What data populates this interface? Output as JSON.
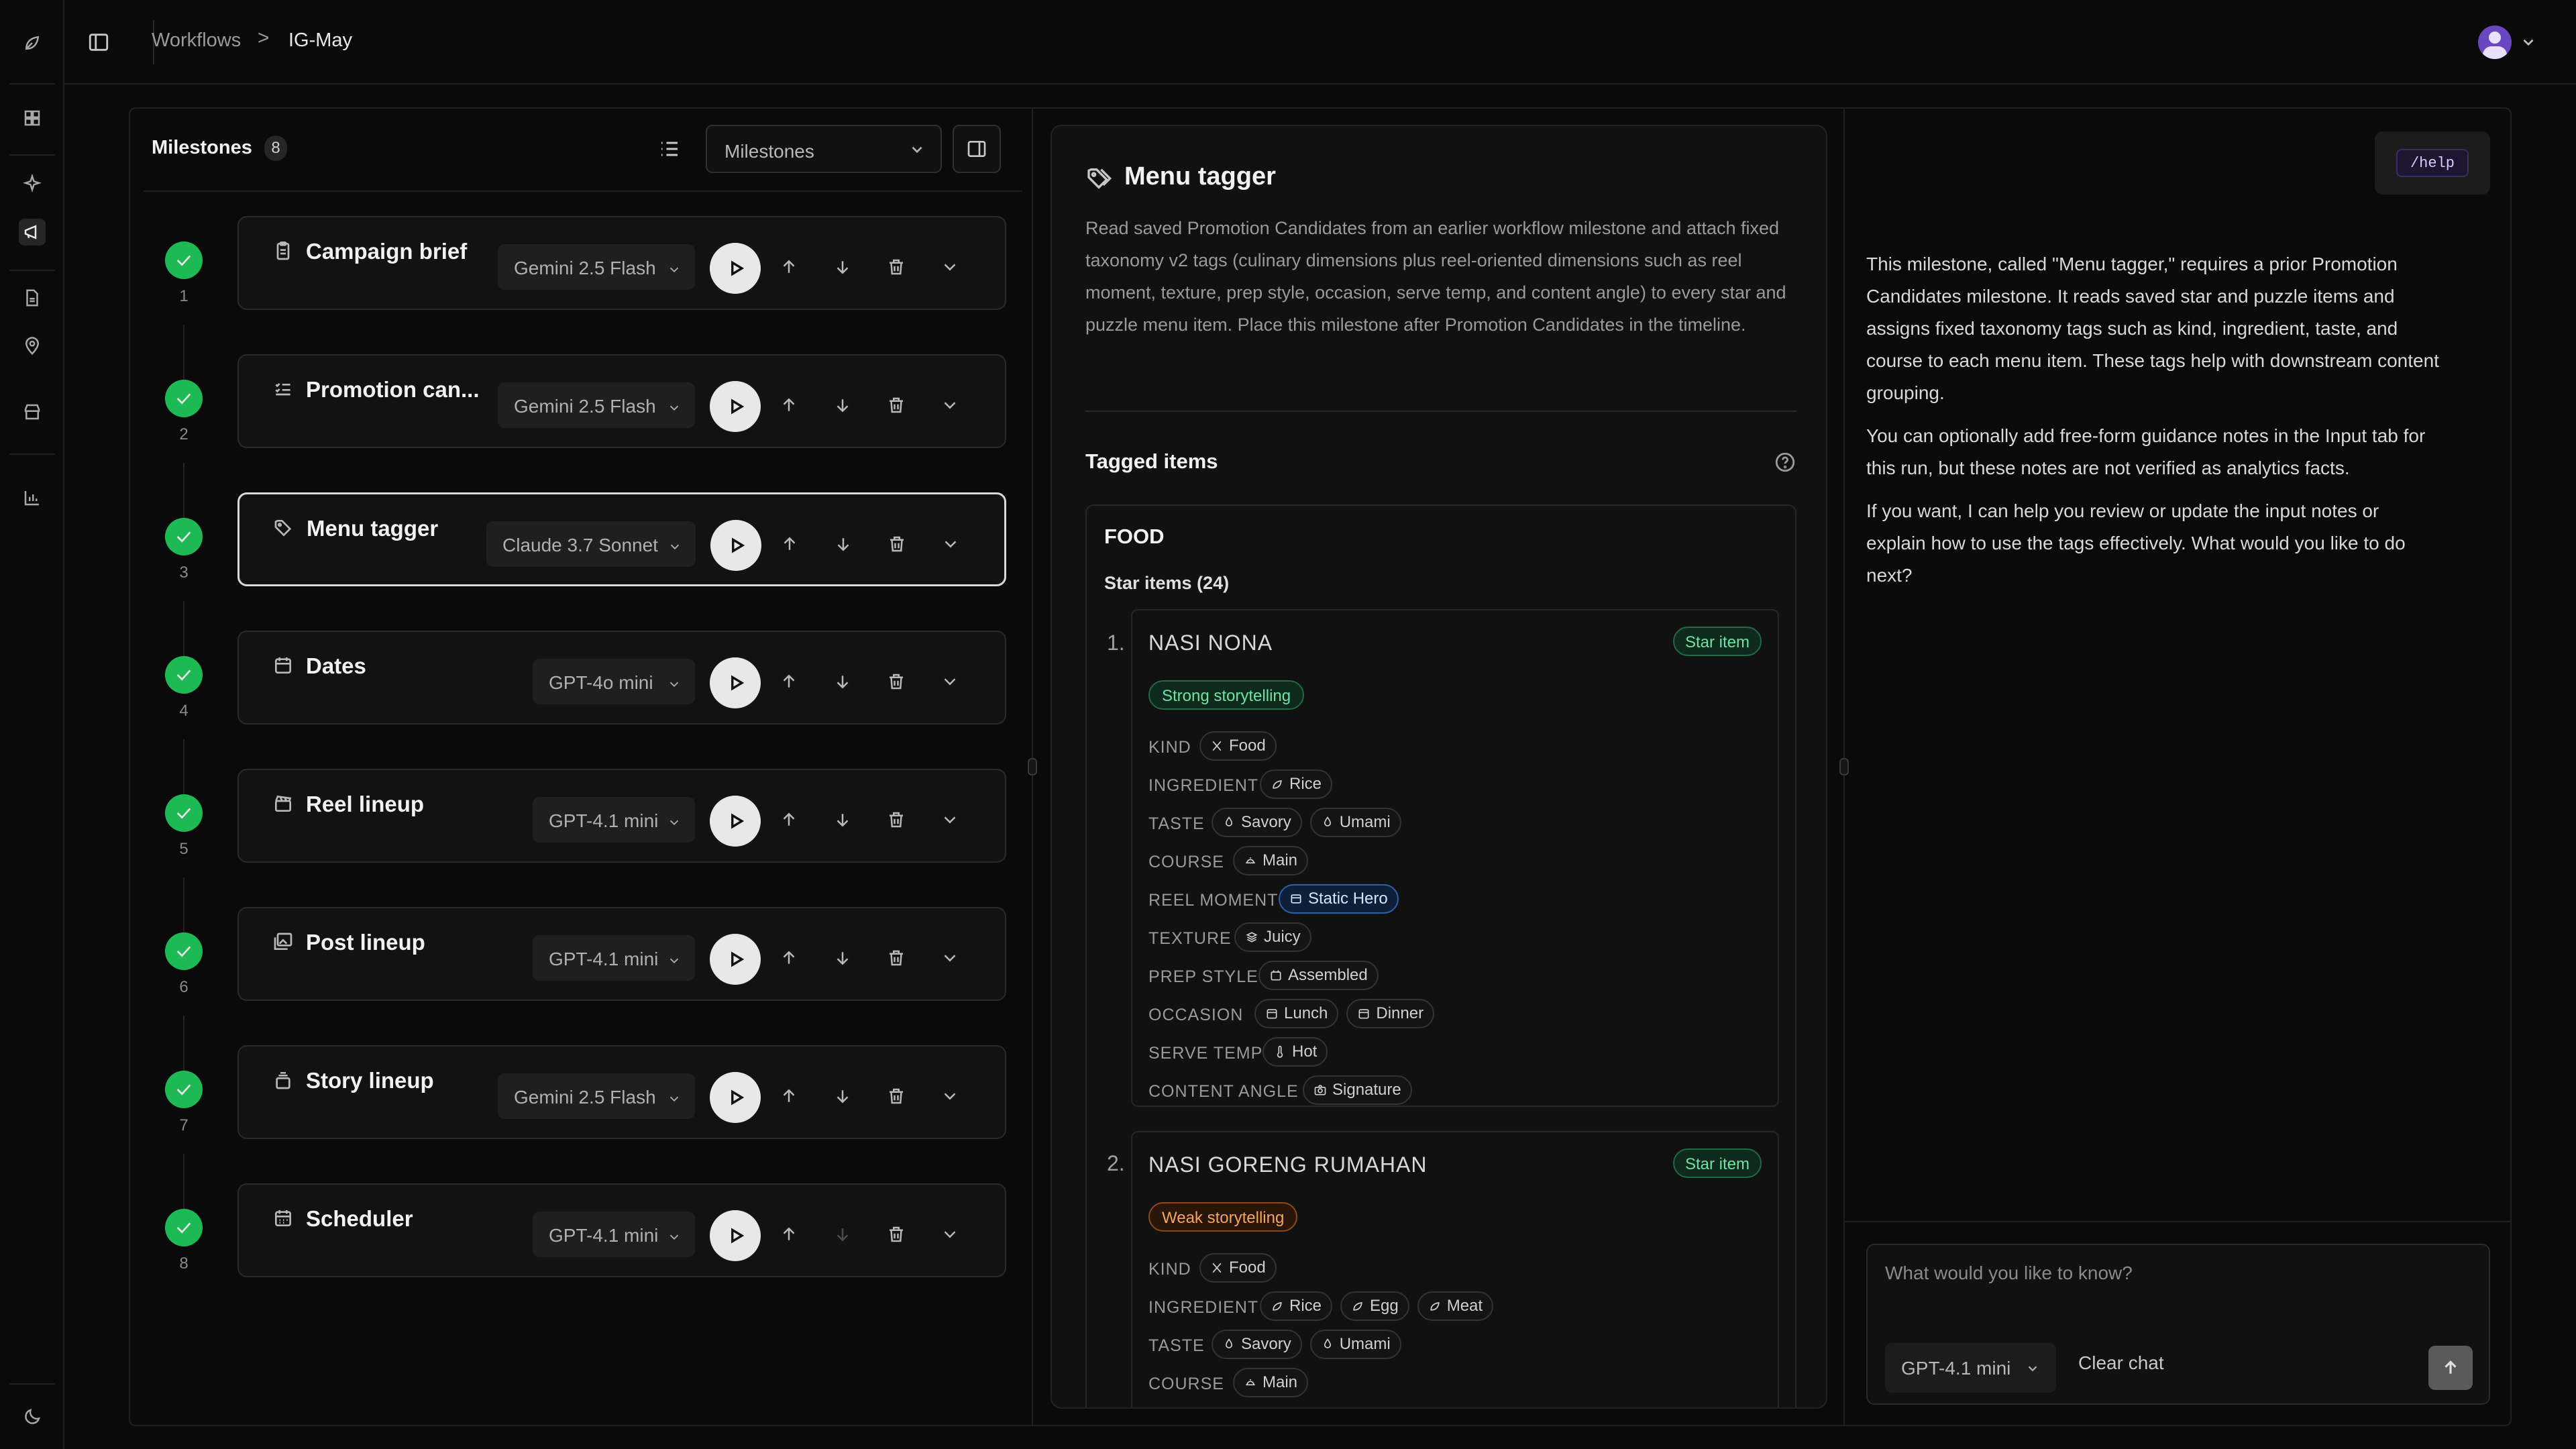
{
  "breadcrumb": {
    "parent": "Workflows",
    "separator": ">",
    "current": "IG-May"
  },
  "milestones_panel": {
    "title": "Milestones",
    "count": "8",
    "view_select": "Milestones",
    "items": [
      {
        "num": "1",
        "title": "Campaign brief",
        "model": "Gemini 2.5 Flash",
        "icon": "clipboard-icon"
      },
      {
        "num": "2",
        "title": "Promotion can...",
        "model": "Gemini 2.5 Flash",
        "icon": "list-check-icon"
      },
      {
        "num": "3",
        "title": "Menu tagger",
        "model": "Claude 3.7 Sonnet",
        "icon": "tags-icon"
      },
      {
        "num": "4",
        "title": "Dates",
        "model": "GPT-4o mini",
        "icon": "calendar-icon"
      },
      {
        "num": "5",
        "title": "Reel lineup",
        "model": "GPT-4.1 mini",
        "icon": "clapperboard-icon"
      },
      {
        "num": "6",
        "title": "Post lineup",
        "model": "GPT-4.1 mini",
        "icon": "images-icon"
      },
      {
        "num": "7",
        "title": "Story lineup",
        "model": "Gemini 2.5 Flash",
        "icon": "layers-icon"
      },
      {
        "num": "8",
        "title": "Scheduler",
        "model": "GPT-4.1 mini",
        "icon": "calendar-days-icon"
      }
    ]
  },
  "detail": {
    "title": "Menu tagger",
    "description": "Read saved Promotion Candidates from an earlier workflow milestone and attach fixed taxonomy v2 tags (culinary dimensions plus reel-oriented dimensions such as reel moment, texture, prep style, occasion, serve temp, and content angle) to every star and puzzle menu item. Place this milestone after Promotion Candidates in the timeline.",
    "tagged_title": "Tagged items",
    "group": "FOOD",
    "star_heading": "Star items (24)",
    "items": [
      {
        "num": "1.",
        "name": "NASI NONA",
        "badge": "Star item",
        "story": "Strong storytelling",
        "tags": [
          {
            "label": "KIND",
            "values": [
              "Food"
            ]
          },
          {
            "label": "INGREDIENT",
            "values": [
              "Rice"
            ]
          },
          {
            "label": "TASTE",
            "values": [
              "Savory",
              "Umami"
            ]
          },
          {
            "label": "COURSE",
            "values": [
              "Main"
            ]
          },
          {
            "label": "REEL MOMENT",
            "values": [
              "Static Hero"
            ]
          },
          {
            "label": "TEXTURE",
            "values": [
              "Juicy"
            ]
          },
          {
            "label": "PREP STYLE",
            "values": [
              "Assembled"
            ]
          },
          {
            "label": "OCCASION",
            "values": [
              "Lunch",
              "Dinner"
            ]
          },
          {
            "label": "SERVE TEMP",
            "values": [
              "Hot"
            ]
          },
          {
            "label": "CONTENT ANGLE",
            "values": [
              "Signature"
            ]
          }
        ]
      },
      {
        "num": "2.",
        "name": "NASI GORENG RUMAHAN",
        "badge": "Star item",
        "story": "Weak storytelling",
        "tags": [
          {
            "label": "KIND",
            "values": [
              "Food"
            ]
          },
          {
            "label": "INGREDIENT",
            "values": [
              "Rice",
              "Egg",
              "Meat"
            ]
          },
          {
            "label": "TASTE",
            "values": [
              "Savory",
              "Umami"
            ]
          },
          {
            "label": "COURSE",
            "values": [
              "Main"
            ]
          }
        ]
      }
    ]
  },
  "chat": {
    "help_command": "/help",
    "paragraphs": [
      "This milestone, called \"Menu tagger,\" requires a prior Promotion Candidates milestone. It reads saved star and puzzle items and assigns fixed taxonomy tags such as kind, ingredient, taste, and course to each menu item. These tags help with downstream content grouping.",
      "You can optionally add free-form guidance notes in the Input tab for this run, but these notes are not verified as analytics facts.",
      "If you want, I can help you review or update the input notes or explain how to use the tags effectively. What would you like to do next?"
    ],
    "input_placeholder": "What would you like to know?",
    "model": "GPT-4.1 mini",
    "clear_label": "Clear chat"
  },
  "colors": {
    "success": "#1db954",
    "accent_blue": "#2f5fa8",
    "warn": "#f3a65a"
  }
}
